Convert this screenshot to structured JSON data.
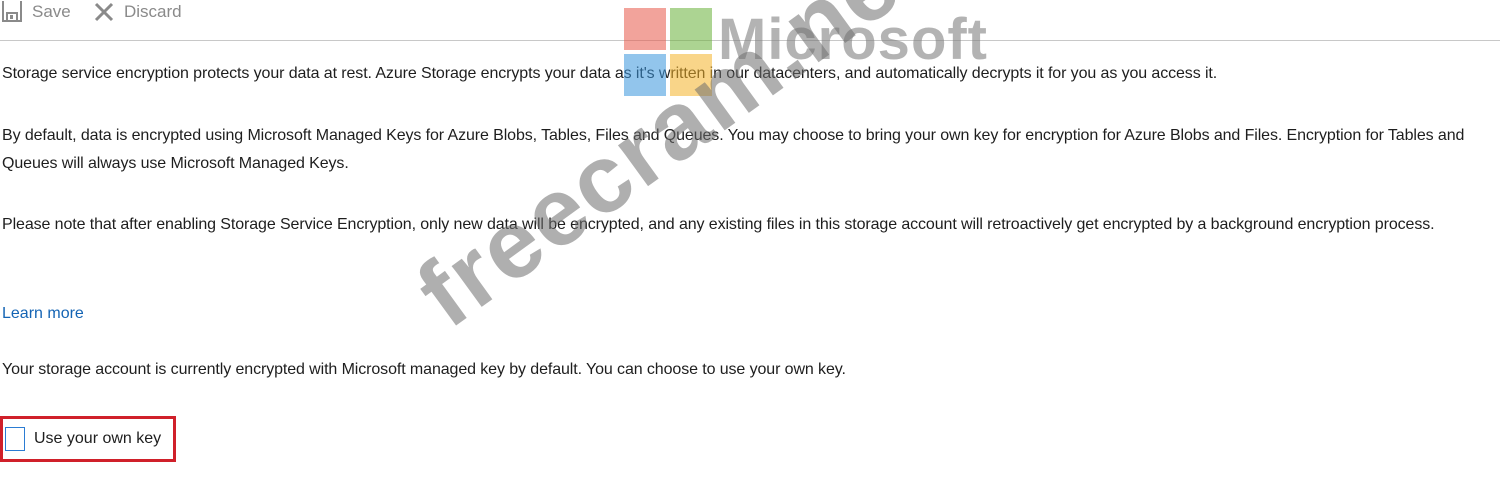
{
  "toolbar": {
    "save_label": "Save",
    "discard_label": "Discard"
  },
  "content": {
    "p1": "Storage service encryption protects your data at rest. Azure Storage encrypts your data as it's written in our datacenters, and automatically decrypts it for you as you access it.",
    "p2": "By default, data is encrypted using Microsoft Managed Keys for Azure Blobs, Tables, Files and Queues. You may choose to bring your own key for encryption for Azure Blobs and Files. Encryption for Tables and Queues will always use Microsoft Managed Keys.",
    "p3": "Please note that after enabling Storage Service Encryption, only new data will be encrypted, and any existing files in this storage account will retroactively get encrypted by a background encryption process.",
    "learn_more": "Learn more",
    "p4": "Your storage account is currently encrypted with Microsoft managed key by default. You can choose to use your own key.",
    "own_key_label": "Use your own key",
    "own_key_checked": false
  },
  "watermark": {
    "logo_text": "Microsoft",
    "site_text": "freecram.net",
    "colors": {
      "red": "#e8594a",
      "green": "#6ab23a",
      "blue": "#3a96dd",
      "yellow": "#f5b42a"
    }
  },
  "colors": {
    "link": "#1464b4",
    "highlight_border": "#d0202a",
    "checkbox_border": "#2b7cd3"
  }
}
